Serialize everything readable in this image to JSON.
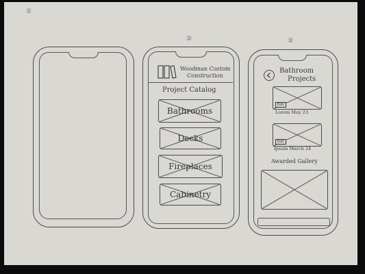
{
  "frames": [
    {
      "number": "①"
    },
    {
      "number": "②"
    },
    {
      "number": "③"
    }
  ],
  "screen2": {
    "logo_icon": "book-logo-icon",
    "company_name_line1": "Woodman Custom",
    "company_name_line2": "Construction",
    "section_title": "Project Catalog",
    "categories": [
      {
        "label": "Bathrooms"
      },
      {
        "label": "Decks"
      },
      {
        "label": "Fireplaces"
      },
      {
        "label": "Cabinetry"
      }
    ]
  },
  "screen3": {
    "back_icon": "back-arrow-icon",
    "title_line1": "Bathroom",
    "title_line2": "Projects",
    "projects": [
      {
        "tag": "Edit",
        "caption": "Lorem May 23"
      },
      {
        "tag": "Edit",
        "caption": "Ipsum March 24"
      }
    ],
    "gallery_title": "Awarded Gallery"
  }
}
